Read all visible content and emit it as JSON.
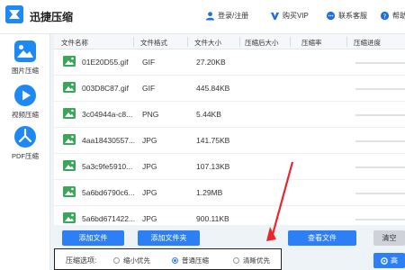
{
  "app": {
    "title": "迅捷压缩"
  },
  "header": {
    "login": "登录/注册",
    "vip": "购买VIP",
    "support": "联系客服",
    "help": "帮助"
  },
  "sidebar": {
    "items": [
      {
        "label": "图片压缩",
        "icon": "image-icon"
      },
      {
        "label": "视频压缩",
        "icon": "play-icon"
      },
      {
        "label": "PDF压缩",
        "icon": "pdf-icon"
      }
    ]
  },
  "table": {
    "headers": [
      "文件名称",
      "文件格式",
      "文件大小",
      "压缩后大小",
      "压缩率",
      "压缩进度"
    ],
    "rows": [
      {
        "name": "01E20D55.gif",
        "format": "GIF",
        "size": "27.20KB"
      },
      {
        "name": "003D8C87.gif",
        "format": "GIF",
        "size": "445.84KB"
      },
      {
        "name": "3c04944a-c8...",
        "format": "PNG",
        "size": "5.44KB"
      },
      {
        "name": "4aa18430557...",
        "format": "JPG",
        "size": "141.75KB"
      },
      {
        "name": "5a3c9fe5910...",
        "format": "JPG",
        "size": "107.13KB"
      },
      {
        "name": "5a6bd6790c6...",
        "format": "JPG",
        "size": "1.29MB"
      },
      {
        "name": "5a6bd671422...",
        "format": "JPG",
        "size": "900.11KB"
      }
    ]
  },
  "actions": {
    "add_file": "添加文件",
    "add_folder": "添加文件夹",
    "view_file": "查看文件",
    "clear": "清空",
    "start": "高"
  },
  "options": {
    "label": "压缩选项:",
    "choices": [
      {
        "label": "缩小优先",
        "selected": false
      },
      {
        "label": "普通压缩",
        "selected": true
      },
      {
        "label": "清晰优先",
        "selected": false
      }
    ]
  },
  "colors": {
    "accent": "#2d7ff6",
    "annotation": "#e8262b"
  }
}
